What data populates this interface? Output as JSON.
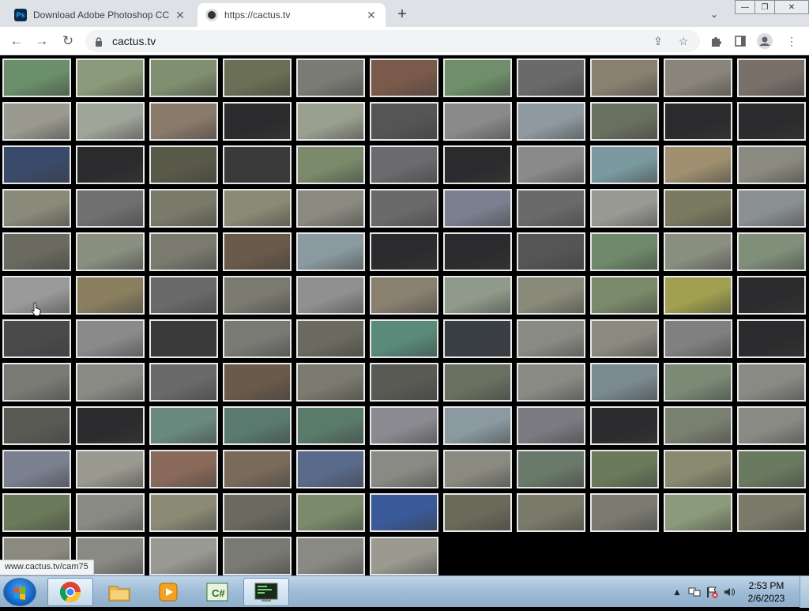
{
  "browser": {
    "tabs": [
      {
        "title": "Download Adobe Photoshop CC",
        "favicon": "photoshop-icon",
        "active": false
      },
      {
        "title": "https://cactus.tv",
        "favicon": "globe-icon",
        "active": true
      }
    ],
    "new_tab": "+",
    "url": "cactus.tv",
    "status_url": "www.cactus.tv/cam75"
  },
  "icons": {
    "back": "back-arrow-icon",
    "forward": "forward-arrow-icon",
    "reload": "reload-icon",
    "lock": "lock-icon",
    "share": "share-icon",
    "bookmark": "star-icon",
    "extensions": "puzzle-icon",
    "sidepanel": "side-panel-icon",
    "profile": "profile-icon",
    "menu": "kebab-menu-icon"
  },
  "camera_grid": {
    "columns": 11,
    "rows": [
      [
        "#6a8f6a",
        "#8a9a7a",
        "#7f8f6f",
        "#6a6f55",
        "#7b7b75",
        "#7a5a4a",
        "#6f8f6a",
        "#6a6a6a",
        "#8a8070",
        "#8a857a",
        "#7a706a"
      ],
      [
        "#9a9a90",
        "#a0a59a",
        "#8a7a6a",
        "#2b2b2d",
        "#9aa090",
        "#555555",
        "#8a8a8a",
        "#8f9aa0",
        "#6a7060",
        "#2b2b2d",
        "#2b2b2d"
      ],
      [
        "#3a4a6a",
        "#2b2b2d",
        "#5a5a4a",
        "#3a3a3a",
        "#7a8a6a",
        "#6a6a6f",
        "#2b2b2d",
        "#8a8a8a",
        "#7a9aa0",
        "#a09070",
        "#8a8a80"
      ],
      [
        "#8a8a7a",
        "#707070",
        "#7a7a6a",
        "#8a8a75",
        "#8a8a80",
        "#6a6a6a",
        "#7a8090",
        "#6a6a6a",
        "#9a9a95",
        "#7a7a60",
        "#8a9090"
      ],
      [
        "#6a6a60",
        "#8a8f80",
        "#7a7a6f",
        "#6a5a4a",
        "#8a9aa0",
        "#2b2b2d",
        "#2b2b2d",
        "#555555",
        "#6f8a6a",
        "#8a8f80",
        "#7f8f7a"
      ],
      [
        "#9a9a9a",
        "#8a8060",
        "#6a6a6a",
        "#7a7a70",
        "#909090",
        "#8a8070",
        "#909a8a",
        "#8a8a7a",
        "#7a8a6a",
        "#a0a050",
        "#2b2b2d"
      ],
      [
        "#4a4a4a",
        "#8a8a8a",
        "#3a3a3a",
        "#7a7a75",
        "#6a6a60",
        "#5a8a7a",
        "#3a3f45",
        "#8a8a85",
        "#8a8a80",
        "#808080",
        "#2b2b2d"
      ],
      [
        "#7a7a75",
        "#8a8a85",
        "#6a6a6a",
        "#6a5a4a",
        "#7a7a6f",
        "#5a5a55",
        "#6a7060",
        "#8a8a85",
        "#7a8a90",
        "#7a8a75",
        "#8a8a85"
      ],
      [
        "#5a5a55",
        "#2b2b2d",
        "#6a8a80",
        "#5a7a70",
        "#5a7a6a",
        "#8a8a90",
        "#8a9aa0",
        "#7a7a80",
        "#2b2b2d",
        "#7a8070",
        "#8a8a85"
      ],
      [
        "#7a8090",
        "#9a9a90",
        "#8a6a5a",
        "#7a6a5a",
        "#5a6a8a",
        "#8a8a85",
        "#8a8a80",
        "#6a7a6a",
        "#6a7a5a",
        "#8a8a70",
        "#6a7a60"
      ],
      [
        "#6a7a5a",
        "#8a8a85",
        "#8a8a75",
        "#6a6a60",
        "#7a8a6a",
        "#3a5a9a",
        "#6a6a5a",
        "#7a7a6a",
        "#7a7a70",
        "#8a9a7a",
        "#7a7a6a"
      ],
      [
        "#8a8a80",
        "#8a8a85",
        "#9a9a95",
        "#7a7a75",
        "#8a8a85",
        "#9a9a90"
      ]
    ]
  },
  "taskbar": {
    "items": [
      "start-orb-icon",
      "chrome-icon",
      "explorer-icon",
      "media-player-icon",
      "csharp-icon",
      "terminal-icon"
    ],
    "clock_time": "2:53 PM",
    "clock_date": "2/6/2023"
  },
  "colors": {
    "tabstrip": "#dee1e6",
    "grid_bg": "#000000",
    "thumb_border": "#e8e8e8",
    "taskbar": "#9fbcd6"
  }
}
